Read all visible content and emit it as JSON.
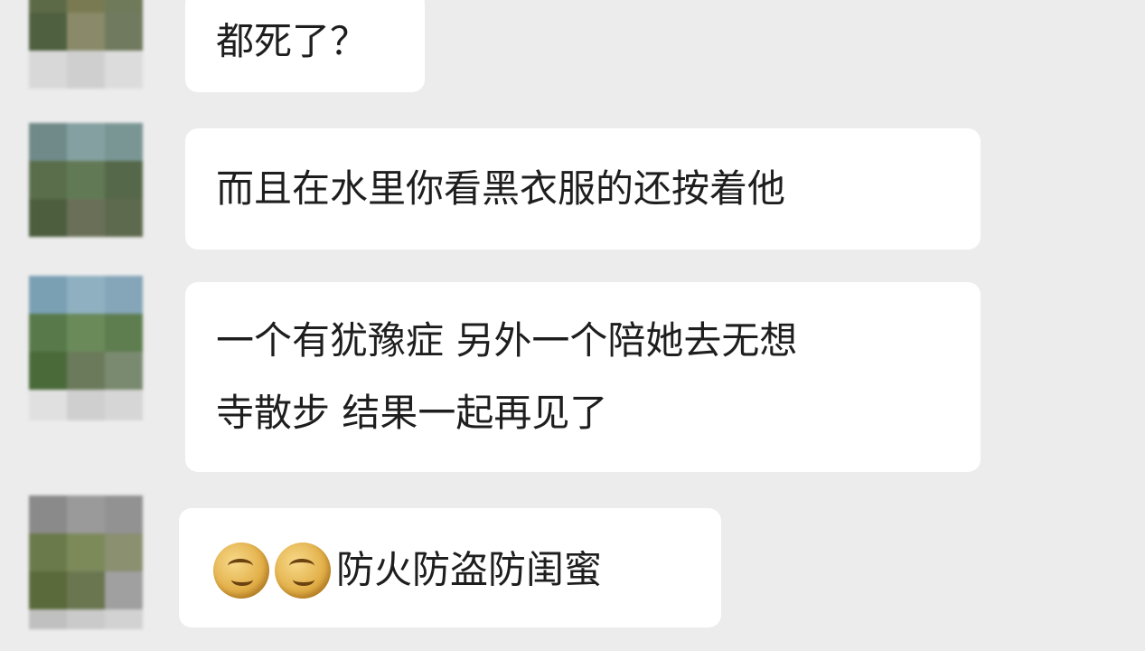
{
  "messages": [
    {
      "text": "都死了？"
    },
    {
      "text": "而且在水里你看黑衣服的还按着他"
    },
    {
      "lines": [
        "一个有犹豫症 另外一个陪她去无想",
        "寺散步 结果一起再见了"
      ]
    },
    {
      "emojis": [
        "laughing-cry-emoji",
        "laughing-cry-emoji"
      ],
      "text": "防火防盗防闺蜜"
    }
  ],
  "colors": {
    "background": "#ececec",
    "bubble": "#ffffff",
    "text": "#1e1e1e"
  }
}
